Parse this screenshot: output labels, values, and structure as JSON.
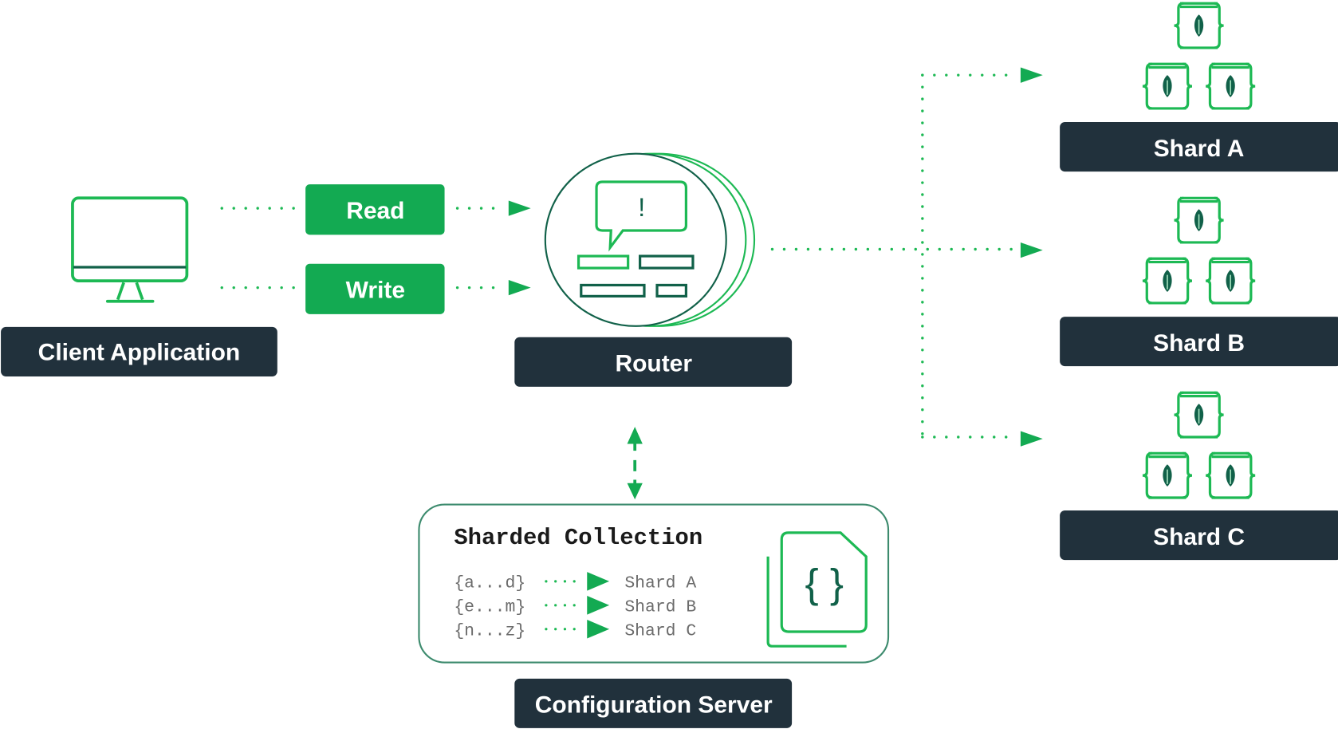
{
  "colors": {
    "green": "#13aa52",
    "bright_green": "#1db954",
    "dark_green": "#116149",
    "label_bg": "#21313c",
    "box_border": "#3d8b6e",
    "text_white": "#ffffff",
    "mono_text": "#6b6b6b"
  },
  "client": {
    "label": "Client Application",
    "icon": "monitor-icon"
  },
  "operations": [
    {
      "label": "Read"
    },
    {
      "label": "Write"
    }
  ],
  "router": {
    "label": "Router",
    "icon": "router-alert-icon",
    "alert_glyph": "!"
  },
  "config_server": {
    "label": "Configuration Server",
    "collection_title": "Sharded Collection",
    "icon": "json-document-icon",
    "doc_glyph": "{ }",
    "mappings": [
      {
        "range": "{a...d}",
        "target": "Shard A"
      },
      {
        "range": "{e...m}",
        "target": "Shard B"
      },
      {
        "range": "{n...z}",
        "target": "Shard C"
      }
    ]
  },
  "shards": [
    {
      "label": "Shard A",
      "icon": "database-leaf-icon"
    },
    {
      "label": "Shard B",
      "icon": "database-leaf-icon"
    },
    {
      "label": "Shard C",
      "icon": "database-leaf-icon"
    }
  ]
}
